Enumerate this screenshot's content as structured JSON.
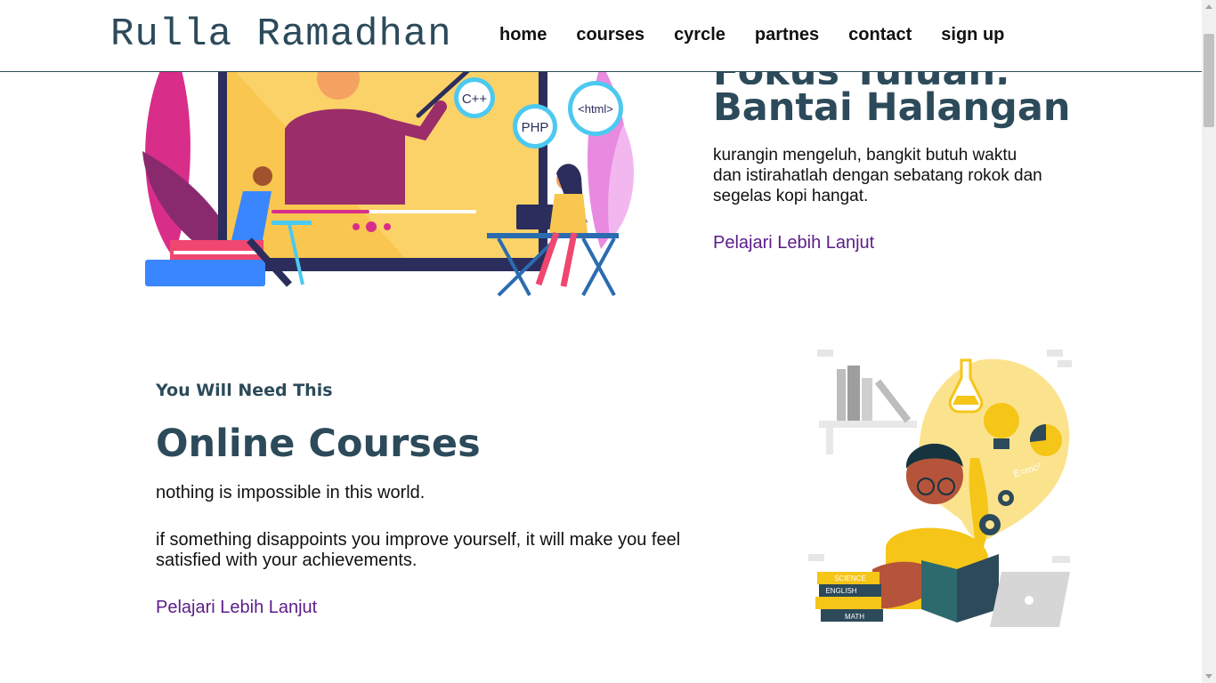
{
  "header": {
    "brand": "Rulla Ramadhan",
    "nav": [
      "home",
      "courses",
      "cyrcle",
      "partnes",
      "contact",
      "sign up"
    ]
  },
  "hero": {
    "heading_line1": "Fokus Tujuan,",
    "heading_line2": "Bantai Halangan",
    "paragraph": "kurangin mengeluh, bangkit butuh waktu dan istirahatlah dengan sebatang rokok dan segelas kopi hangat.",
    "link": "Pelajari Lebih Lanjut",
    "illustration": {
      "badges": [
        "C++",
        "PHP",
        "<html>"
      ]
    }
  },
  "courses": {
    "subtitle": "You Will Need This",
    "heading": "Online Courses",
    "paragraph1": "nothing is impossible in this world.",
    "paragraph2": "if something disappoints you improve yourself, it will make you feel satisfied with your achievements.",
    "link": "Pelajari Lebih Lanjut",
    "illustration": {
      "book_labels": [
        "SCIENCE",
        "ENGLISH",
        "MATH"
      ]
    }
  },
  "colors": {
    "primary": "#2c4a5a",
    "link": "#5b1d8a",
    "accent_yellow": "#f5c518"
  }
}
